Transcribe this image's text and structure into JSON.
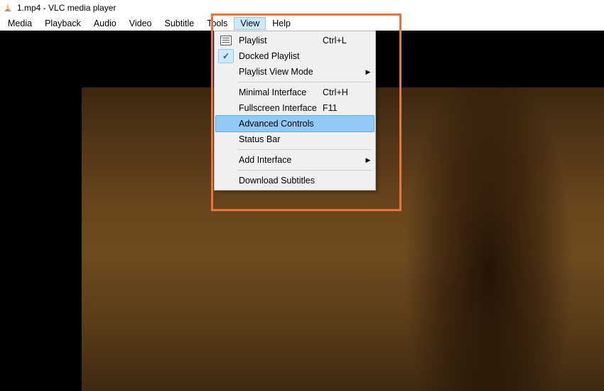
{
  "title": "1.mp4 - VLC media player",
  "menubar": {
    "items": [
      "Media",
      "Playback",
      "Audio",
      "Video",
      "Subtitle",
      "Tools",
      "View",
      "Help"
    ],
    "active": "View"
  },
  "dropdown": {
    "items": [
      {
        "label": "Playlist",
        "shortcut": "Ctrl+L",
        "icon": "playlist"
      },
      {
        "label": "Docked Playlist",
        "checked": true
      },
      {
        "label": "Playlist View Mode",
        "submenu": true
      },
      {
        "sep": true
      },
      {
        "label": "Minimal Interface",
        "shortcut": "Ctrl+H"
      },
      {
        "label": "Fullscreen Interface",
        "shortcut": "F11"
      },
      {
        "label": "Advanced Controls",
        "hovered": true
      },
      {
        "label": "Status Bar"
      },
      {
        "sep": true
      },
      {
        "label": "Add Interface",
        "submenu": true
      },
      {
        "sep": true
      },
      {
        "label": "Download Subtitles"
      }
    ]
  }
}
